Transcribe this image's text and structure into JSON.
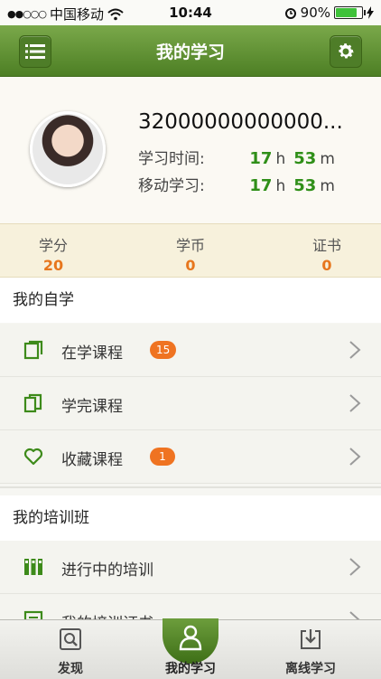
{
  "status_bar": {
    "signal": "●●○○○",
    "carrier": "中国移动",
    "time": "10:44",
    "battery": "90%",
    "battery_level": 0.9
  },
  "navbar": {
    "title": "我的学习",
    "menu_icon": "menu-icon",
    "settings_icon": "gear-icon"
  },
  "profile": {
    "username": "32000000000000...",
    "study_time": {
      "label": "学习时间:",
      "hours": "17",
      "h": "h",
      "minutes": "53",
      "m": "m"
    },
    "mobile_study": {
      "label": "移动学习:",
      "hours": "17",
      "h": "h",
      "minutes": "53",
      "m": "m"
    }
  },
  "counters": [
    {
      "label": "学分",
      "value": "20"
    },
    {
      "label": "学币",
      "value": "0"
    },
    {
      "label": "证书",
      "value": "0"
    }
  ],
  "self_study": {
    "title": "我的自学",
    "items": [
      {
        "label": "在学课程",
        "badge": "15",
        "icon": "book-icon"
      },
      {
        "label": "学完课程",
        "badge": "",
        "icon": "books-icon"
      },
      {
        "label": "收藏课程",
        "badge": "1",
        "icon": "heart-icon"
      }
    ]
  },
  "training": {
    "title": "我的培训班",
    "items": [
      {
        "label": "进行中的培训",
        "icon": "bars-icon"
      },
      {
        "label": "我的培训证书",
        "icon": "certificate-icon"
      }
    ]
  },
  "tabs": [
    {
      "label": "发现",
      "icon": "search-icon",
      "active": false
    },
    {
      "label": "我的学习",
      "icon": "person-icon",
      "active": true
    },
    {
      "label": "离线学习",
      "icon": "download-icon",
      "active": false
    }
  ],
  "colors": {
    "accent_green": "#4d7f24",
    "number_green": "#2f8f18",
    "badge_orange": "#ef7321",
    "counter_orange": "#e7761d"
  }
}
